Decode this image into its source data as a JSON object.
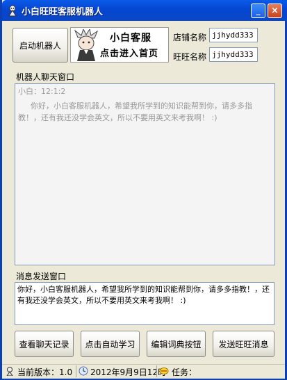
{
  "window": {
    "title": "小白旺旺客服机器人",
    "min_glyph": "_",
    "close_glyph": "×"
  },
  "toolbar": {
    "start_robot": "启动机器人"
  },
  "banner": {
    "line1": "小白客服",
    "line2": "点击进入首页"
  },
  "fields": {
    "store_label": "店铺名称",
    "store_value": "jjhydd333",
    "wangwang_label": "旺旺名称",
    "wangwang_value": "jjhydd333"
  },
  "chat": {
    "label": "机器人聊天窗口",
    "sender_time": "小白：12:1:2",
    "message": "你好，小白客服机器人，希望我所学到的知识能帮到你，请多多指教！，还有我还没学会英文，所以不要用英文来考我啊！ :)"
  },
  "send": {
    "label": "消息发送窗口",
    "value": "你好，小白客服机器人，希望我所学到的知识能帮到你，请多多指教！，还有我还没学会英文，所以不要用英文来考我啊！ :)"
  },
  "actions": {
    "view_history": "查看聊天记录",
    "auto_learn": "点击自动学习",
    "edit_dictionary": "编辑词典按钮",
    "send_message": "发送旺旺消息"
  },
  "status": {
    "version": "当前版本：1.0",
    "datetime": "2012年9月9日12时",
    "task": "任务："
  },
  "colors": {
    "titlebar": "#0546d2",
    "window_bg": "#ece9d8",
    "input_border": "#7f9db9"
  },
  "icons": [
    "app-icon",
    "minimize-icon",
    "close-icon",
    "clock-icon",
    "task-icon",
    "version-icon"
  ]
}
